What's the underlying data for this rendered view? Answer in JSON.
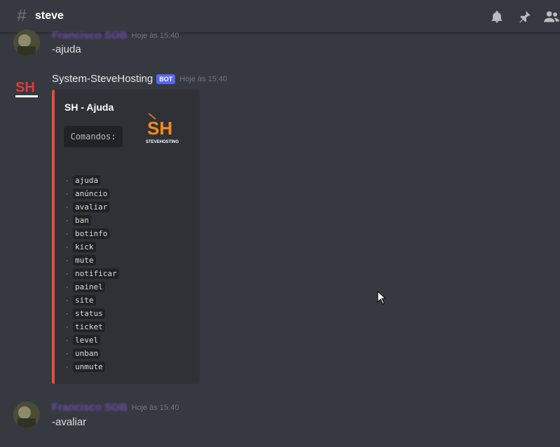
{
  "channel": {
    "name": "steve"
  },
  "messages": [
    {
      "author": "Francisco SOB",
      "timestamp": "Hoje às 15:40",
      "content": "-ajuda"
    },
    {
      "author": "System-SteveHosting",
      "bot_tag": "BOT",
      "timestamp": "Hoje às 15:40",
      "embed": {
        "title": "SH - Ajuda",
        "code_label": "Comandos:",
        "thumbnail_text": "SH",
        "thumbnail_subtext": "STEVEHOSTING",
        "commands": [
          "ajuda",
          "anúncio",
          "avaliar",
          "ban",
          "botinfo",
          "kick",
          "mute",
          "notificar",
          "painel",
          "site",
          "status",
          "ticket",
          "level",
          "unban",
          "unmute"
        ]
      }
    },
    {
      "author": "Francisco SOB",
      "timestamp": "Hoje às 15:40",
      "content": "-avaliar"
    }
  ],
  "colors": {
    "embed_accent": "#e74c3c",
    "bot_tag": "#5865f2",
    "background": "#36393f"
  },
  "icons": [
    "hashtag-icon",
    "bell-icon",
    "pin-icon",
    "members-icon",
    "cursor-icon"
  ]
}
